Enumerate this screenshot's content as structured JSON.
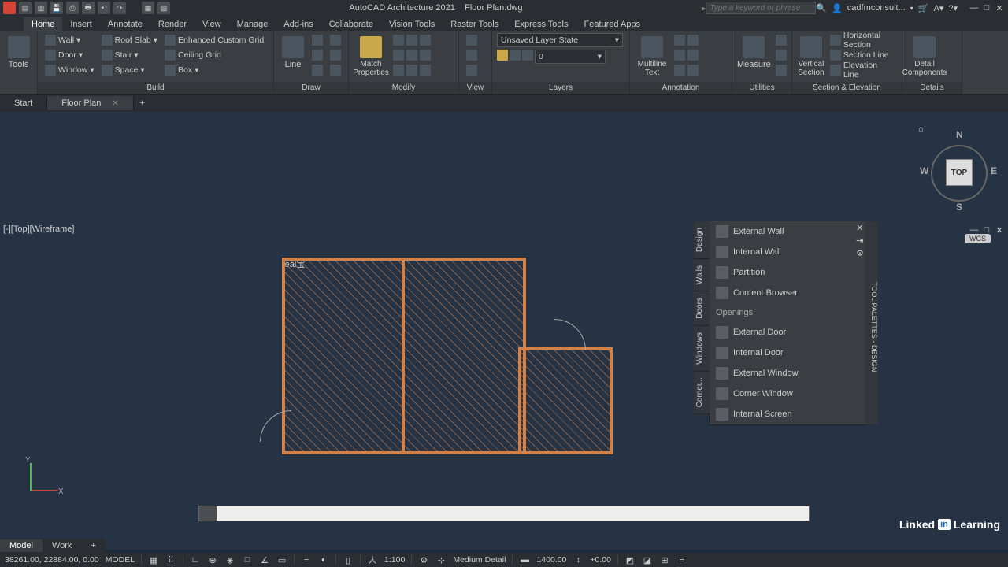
{
  "title": {
    "app": "AutoCAD Architecture 2021",
    "file": "Floor Plan.dwg"
  },
  "search_placeholder": "Type a keyword or phrase",
  "account": "cadfmconsult...",
  "ribbon_tabs": [
    "Home",
    "Insert",
    "Annotate",
    "Render",
    "View",
    "Manage",
    "Add-ins",
    "Collaborate",
    "Vision Tools",
    "Raster Tools",
    "Express Tools",
    "Featured Apps"
  ],
  "ribbon": {
    "tools": "Tools",
    "build": {
      "label": "Build",
      "items": [
        "Wall",
        "Door",
        "Window",
        "Roof Slab",
        "Stair",
        "Space",
        "Enhanced Custom Grid",
        "Ceiling Grid",
        "Box"
      ]
    },
    "draw": {
      "label": "Draw",
      "line": "Line"
    },
    "modify": {
      "label": "Modify",
      "match": "Match\nProperties"
    },
    "view": {
      "label": "View"
    },
    "layers": {
      "label": "Layers",
      "state": "Unsaved Layer State",
      "current": "0"
    },
    "annotation": {
      "label": "Annotation",
      "mtext": "Multiline\nText",
      "measure": "Measure"
    },
    "utilities": {
      "label": "Utilities"
    },
    "section": {
      "label": "Section & Elevation",
      "vsec": "Vertical\nSection",
      "hsec": "Horizontal Section",
      "sline": "Section Line",
      "eline": "Elevation Line"
    },
    "details": {
      "label": "Details",
      "comp": "Detail\nComponents"
    }
  },
  "file_tabs": {
    "start": "Start",
    "floorplan": "Floor Plan"
  },
  "view_label": "[-][Top][Wireframe]",
  "viewcube": {
    "face": "TOP",
    "n": "N",
    "s": "S",
    "e": "E",
    "w": "W",
    "wcs": "WCS"
  },
  "palette": {
    "title": "TOOL PALETTES - DESIGN",
    "side_tabs": [
      "Design",
      "Walls",
      "Doors",
      "Windows",
      "Corner..."
    ],
    "walls": [
      "External Wall",
      "Internal Wall",
      "Partition",
      "Content Browser"
    ],
    "openings_label": "Openings",
    "openings": [
      "External Door",
      "Internal Door",
      "External Window",
      "Corner Window",
      "Internal Screen"
    ]
  },
  "ucs": {
    "x": "X",
    "y": "Y"
  },
  "layout_tabs": {
    "model": "Model",
    "work": "Work"
  },
  "status": {
    "coords": "38261.00, 22884.00, 0.00",
    "space": "MODEL",
    "scale": "1:100",
    "detail": "Medium Detail",
    "val1": "1400.00",
    "val2": "+0.00"
  },
  "attribution": {
    "brand": "Linked",
    "in": "in",
    "product": "Learning"
  }
}
